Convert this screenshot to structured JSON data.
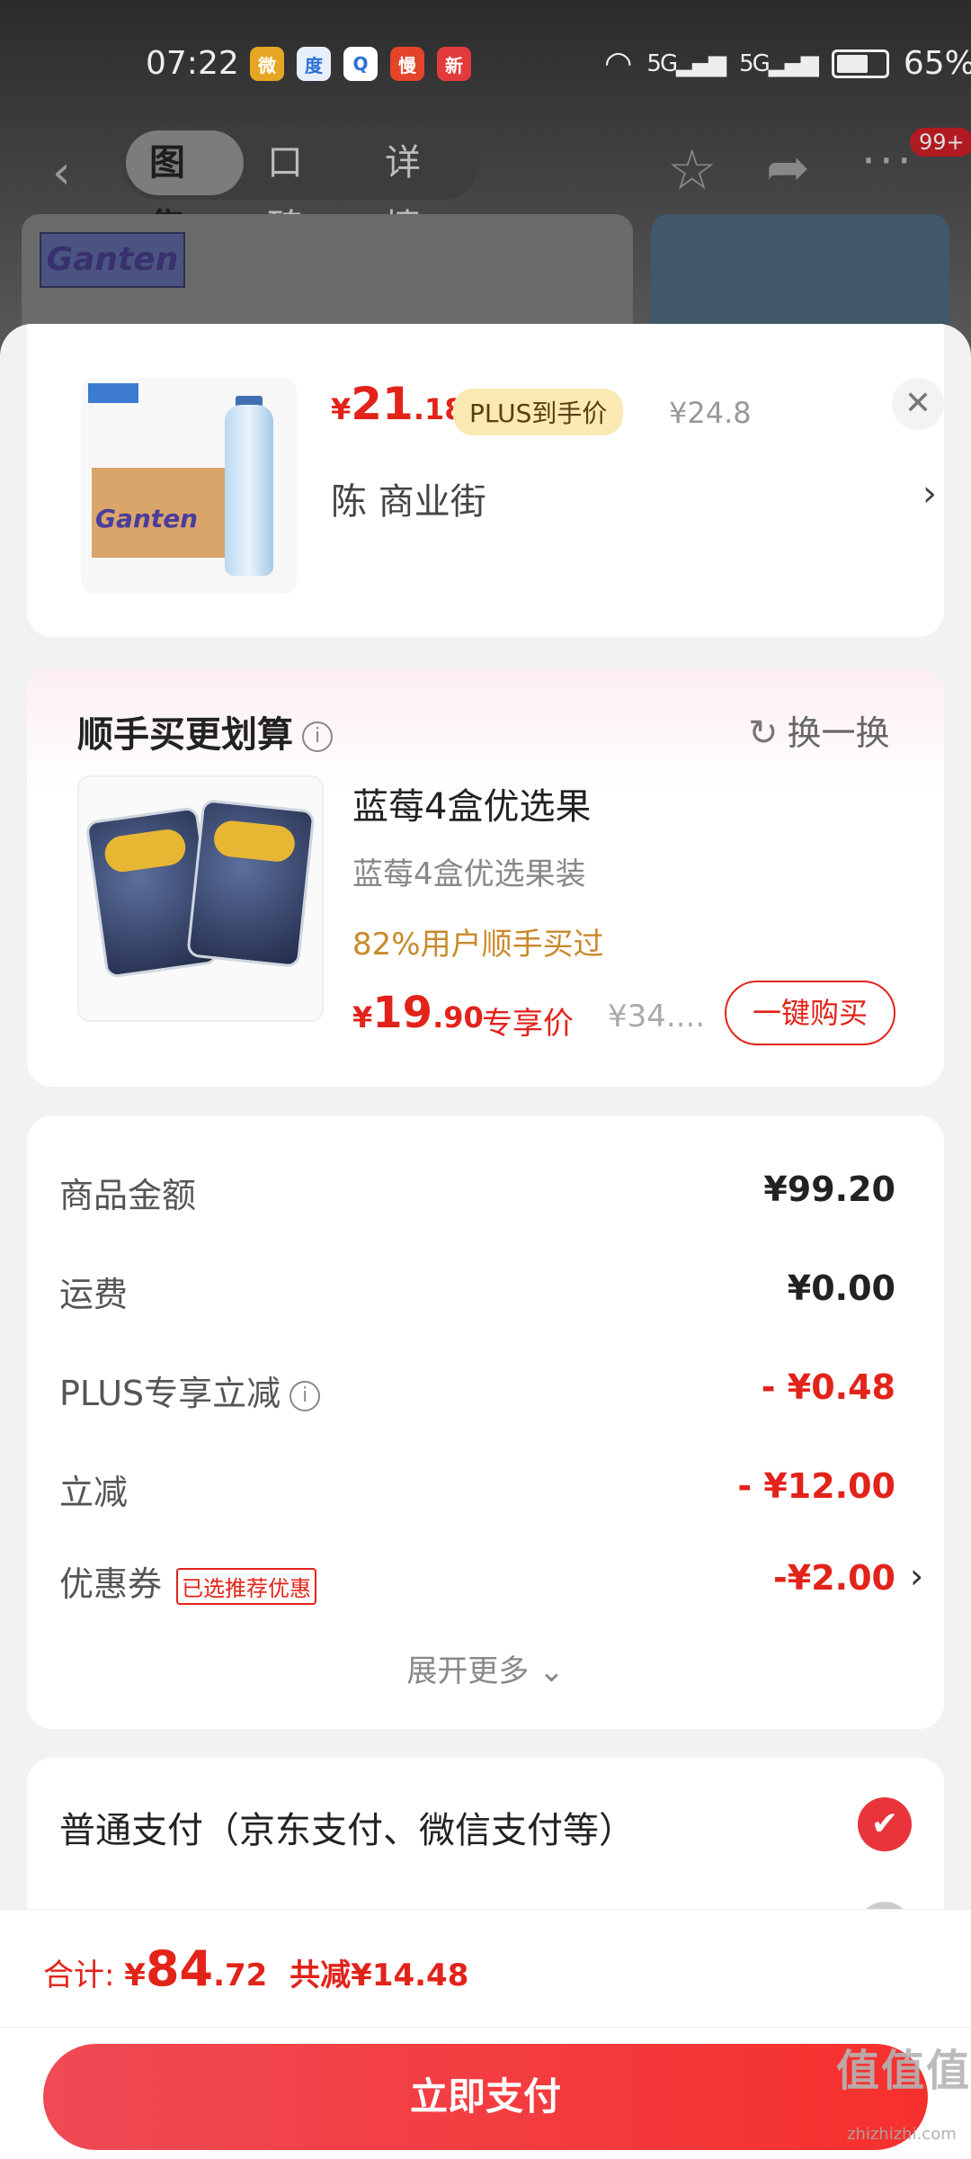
{
  "status_bar": {
    "time": "07:22",
    "apps": [
      {
        "icon": "weibo-icon",
        "glyph": "微",
        "color": "#e6a623"
      },
      {
        "icon": "baidu-icon",
        "glyph": "度",
        "color": "#e8eefc"
      },
      {
        "icon": "search-app-icon",
        "glyph": "Q",
        "color": "#ffffff"
      },
      {
        "icon": "manhua-icon",
        "glyph": "慢",
        "color": "#e4442a"
      },
      {
        "icon": "news-icon",
        "glyph": "新",
        "color": "#e23b3b"
      }
    ],
    "signal1": "5G",
    "signal2": "5G",
    "battery_level": 0.65,
    "battery_text": "65%"
  },
  "nav": {
    "tabs": [
      "图集",
      "口碑",
      "详情"
    ],
    "active_tab": 0,
    "badge": "99+"
  },
  "product": {
    "price_symbol": "¥",
    "price_int": "21",
    "price_dec": ".18",
    "plus_tag": "PLUS到手价",
    "orig_price": "¥24.8",
    "address": "陈  商业街"
  },
  "upsell": {
    "title": "顺手买更划算",
    "swap_label": "换一换",
    "name": "蓝莓4盒优选果",
    "desc": "蓝莓4盒优选果装",
    "bought": "82%用户顺手买过",
    "price_symbol": "¥",
    "price_int": "19",
    "price_dec": ".90",
    "price_tag": "专享价",
    "orig_price": "¥34....",
    "buy_label": "一键购买"
  },
  "summary": {
    "rows": [
      {
        "label": "商品金额",
        "value": "¥99.20",
        "red": false
      },
      {
        "label": "运费",
        "value": "¥0.00",
        "red": false
      },
      {
        "label": "PLUS专享立减",
        "value": "- ¥0.48",
        "red": true
      },
      {
        "label": "立减",
        "value": "- ¥12.00",
        "red": true
      },
      {
        "label": "优惠券",
        "value": "-¥2.00",
        "red": true
      }
    ],
    "coupon_tag": "已选推荐优惠",
    "expand": "展开更多"
  },
  "payment": {
    "method": "普通支付（京东支付、微信支付等）"
  },
  "footer": {
    "total_label": "合计:",
    "symbol": "¥",
    "total_int": "84",
    "total_dec": ".72",
    "reduced": "共减¥14.48",
    "pay_button": "立即支付"
  },
  "watermark": {
    "main": "值值值",
    "sub": "zhizhizhi.com"
  }
}
